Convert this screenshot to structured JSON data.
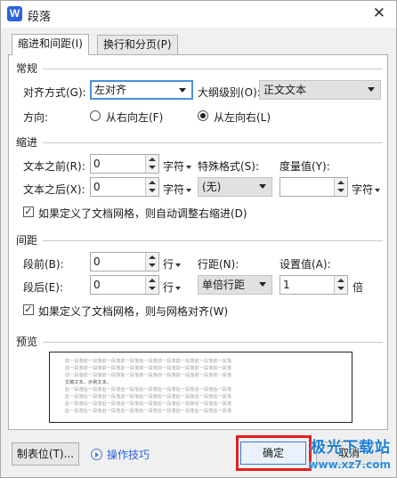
{
  "window": {
    "title": "段落",
    "app_icon": "W",
    "close_glyph": "✕"
  },
  "tabs": [
    {
      "label": "缩进和间距(I)",
      "active": true
    },
    {
      "label": "换行和分页(P)",
      "active": false
    }
  ],
  "general": {
    "section_label": "常规",
    "align_label": "对齐方式(G):",
    "align_value": "左对齐",
    "outline_label": "大纲级别(O):",
    "outline_value": "正文文本",
    "direction_label": "方向:",
    "rtl_label": "从右向左(F)",
    "ltr_label": "从左向右(L)",
    "ltr_selected": true
  },
  "indent": {
    "section_label": "缩进",
    "before_label": "文本之前(R):",
    "before_value": "0",
    "before_unit": "字符",
    "after_label": "文本之后(X):",
    "after_value": "0",
    "after_unit": "字符",
    "special_label": "特殊格式(S):",
    "special_value": "(无)",
    "measure_label": "度量值(Y):",
    "measure_value": "",
    "measure_unit": "字符",
    "grid_check_label": "如果定义了文档网格，则自动调整右缩进(D)",
    "grid_checked": true
  },
  "spacing": {
    "section_label": "间距",
    "before_label": "段前(B):",
    "before_value": "0",
    "before_unit": "行",
    "after_label": "段后(E):",
    "after_value": "0",
    "after_unit": "行",
    "line_label": "行距(N):",
    "line_value": "单倍行距",
    "setting_label": "设置值(A):",
    "setting_value": "1",
    "setting_unit": "倍",
    "grid_check_label": "如果定义了文档网格，则与网格对齐(W)",
    "grid_checked": true
  },
  "preview": {
    "section_label": "预览",
    "line_prev": "前一段落前一段落前一段落前一段落前一段落前一段落前一段落前一段落前一段落",
    "line_sample": "文稿文本，示例文本。",
    "line_next": "后一段落后一段落后一段落后一段落后一段落后一段落后一段落后一段落后一段落"
  },
  "footer": {
    "tabs_button": "制表位(T)...",
    "tips_link": "操作技巧",
    "ok_button": "确定",
    "cancel_button": "取消"
  },
  "watermark": {
    "title": "极光下载站",
    "url": "www.xz7.com"
  },
  "colors": {
    "accent": "#2b62e0",
    "highlight": "#e02020",
    "focus": "#4a90d9"
  }
}
